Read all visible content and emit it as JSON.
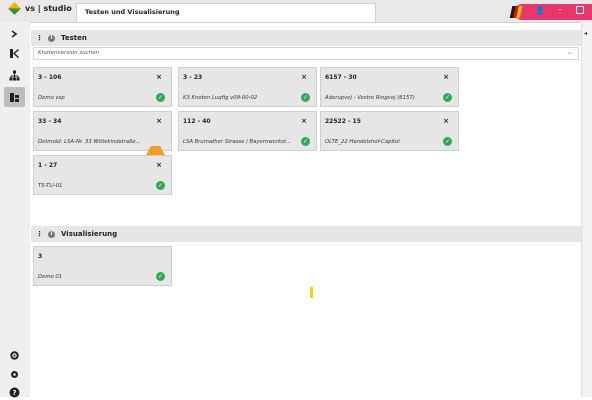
{
  "titlebar": {
    "app_title": "vs | studio",
    "tab_label": "Testen und Visualisierung"
  },
  "colors": {
    "accent": "#e8386b",
    "ok": "#34a853",
    "warn": "#f39c2c"
  },
  "sidebar": {
    "items": [
      {
        "icon": "chevron-right-icon",
        "glyph": "›"
      },
      {
        "icon": "logo-k-icon",
        "glyph": "K"
      },
      {
        "icon": "hierarchy-icon",
        "glyph": "⛶"
      },
      {
        "icon": "node-test-icon",
        "glyph": "E"
      },
      {
        "icon": "settings-icon",
        "glyph": "⚙"
      },
      {
        "icon": "advanced-settings-icon",
        "glyph": "⚙"
      },
      {
        "icon": "help-icon",
        "glyph": "?"
      }
    ]
  },
  "testen": {
    "title": "Testen",
    "search_placeholder": "Knotenversion suchen",
    "cards": [
      {
        "id": "3 - 106",
        "name": "Demo vsp",
        "status": "ok"
      },
      {
        "id": "3 - 23",
        "name": "K3 Knoten Luqfig v09-00-02",
        "status": "ok"
      },
      {
        "id": "6157 - 30",
        "name": "Aderupvej - Vestre Ringvej (6157)",
        "status": "ok"
      },
      {
        "id": "33 - 34",
        "name": "Detmold: LSA-Nr. 33 Wittekindstraße...",
        "status": "warn"
      },
      {
        "id": "112 - 40",
        "name": "LSA Brumather Strasse / Bayernwerkst...",
        "status": "ok"
      },
      {
        "id": "22522 - 15",
        "name": "OLTE_22 Handelshof-Capitol",
        "status": "ok"
      },
      {
        "id": "1 - 27",
        "name": "TS-TLI-01",
        "status": "ok"
      }
    ]
  },
  "visualisierung": {
    "title": "Visualisierung",
    "cards": [
      {
        "id": "3",
        "name": "Demo 01",
        "status": "ok"
      }
    ]
  }
}
